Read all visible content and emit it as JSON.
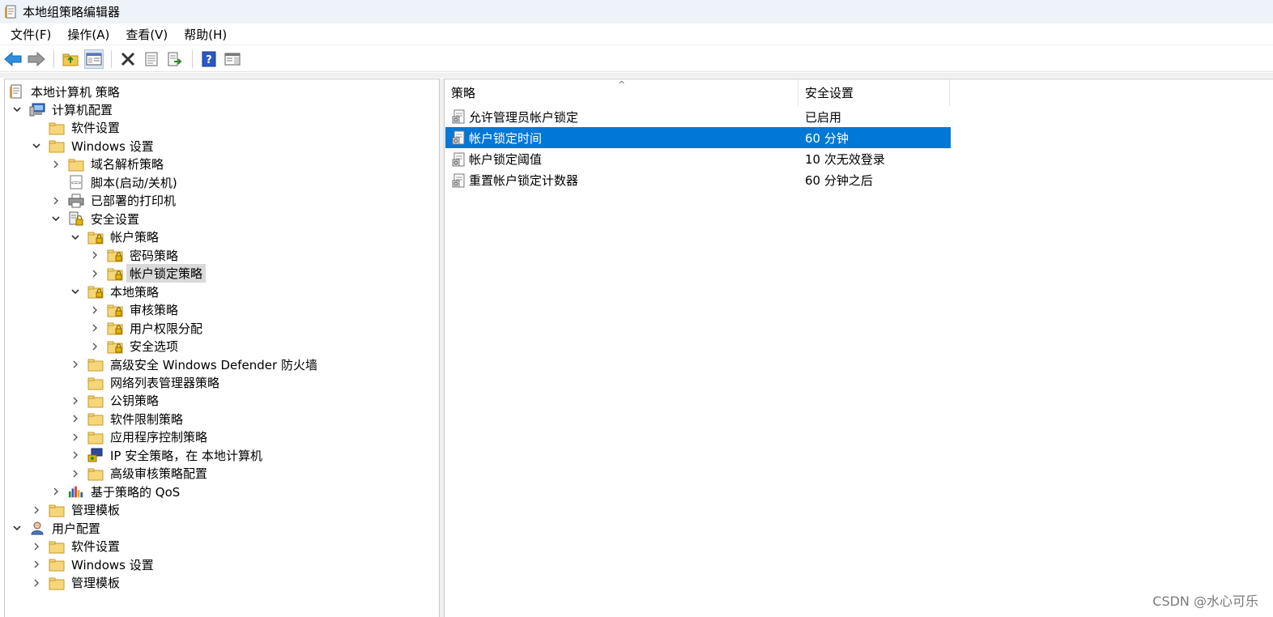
{
  "window": {
    "title": "本地组策略编辑器"
  },
  "menu": [
    "文件(F)",
    "操作(A)",
    "查看(V)",
    "帮助(H)"
  ],
  "toolbar": {
    "buttons": [
      {
        "name": "back-button",
        "icon": "arrow-left-icon"
      },
      {
        "name": "forward-button",
        "icon": "arrow-right-icon"
      },
      {
        "name": "up-folder-button",
        "icon": "folder-up-icon"
      },
      {
        "name": "show-hide-tree-button",
        "icon": "console-tree-icon"
      },
      {
        "name": "delete-button",
        "icon": "delete-x-icon"
      },
      {
        "name": "properties-button",
        "icon": "properties-icon"
      },
      {
        "name": "export-list-button",
        "icon": "export-icon"
      },
      {
        "name": "help-button",
        "icon": "help-icon"
      },
      {
        "name": "show-action-pane-button",
        "icon": "action-pane-icon"
      }
    ]
  },
  "tree": [
    {
      "label": "本地计算机 策略",
      "level": 0,
      "chevron": "none",
      "icon": "policy-document-icon"
    },
    {
      "label": "计算机配置",
      "level": 1,
      "chevron": "down",
      "icon": "computer-icon"
    },
    {
      "label": "软件设置",
      "level": 2,
      "chevron": "none",
      "icon": "folder-icon"
    },
    {
      "label": "Windows 设置",
      "level": 2,
      "chevron": "down",
      "icon": "folder-icon"
    },
    {
      "label": "域名解析策略",
      "level": 3,
      "chevron": "right",
      "icon": "folder-icon"
    },
    {
      "label": "脚本(启动/关机)",
      "level": 3,
      "chevron": "none",
      "icon": "script-icon"
    },
    {
      "label": "已部署的打印机",
      "level": 3,
      "chevron": "right",
      "icon": "printer-icon"
    },
    {
      "label": "安全设置",
      "level": 3,
      "chevron": "down",
      "icon": "security-settings-icon"
    },
    {
      "label": "帐户策略",
      "level": 4,
      "chevron": "down",
      "icon": "locked-folder-icon"
    },
    {
      "label": "密码策略",
      "level": 5,
      "chevron": "right",
      "icon": "locked-folder-icon"
    },
    {
      "label": "帐户锁定策略",
      "level": 5,
      "chevron": "right",
      "icon": "locked-folder-icon",
      "selected": true
    },
    {
      "label": "本地策略",
      "level": 4,
      "chevron": "down",
      "icon": "locked-folder-icon"
    },
    {
      "label": "审核策略",
      "level": 5,
      "chevron": "right",
      "icon": "locked-folder-icon"
    },
    {
      "label": "用户权限分配",
      "level": 5,
      "chevron": "right",
      "icon": "locked-folder-icon"
    },
    {
      "label": "安全选项",
      "level": 5,
      "chevron": "right",
      "icon": "locked-folder-icon"
    },
    {
      "label": "高级安全 Windows Defender 防火墙",
      "level": 4,
      "chevron": "right",
      "icon": "folder-icon"
    },
    {
      "label": "网络列表管理器策略",
      "level": 4,
      "chevron": "none",
      "icon": "folder-icon"
    },
    {
      "label": "公钥策略",
      "level": 4,
      "chevron": "right",
      "icon": "folder-icon"
    },
    {
      "label": "软件限制策略",
      "level": 4,
      "chevron": "right",
      "icon": "folder-icon"
    },
    {
      "label": "应用程序控制策略",
      "level": 4,
      "chevron": "right",
      "icon": "folder-icon"
    },
    {
      "label": "IP 安全策略，在 本地计算机",
      "level": 4,
      "chevron": "right",
      "icon": "ip-security-icon"
    },
    {
      "label": "高级审核策略配置",
      "level": 4,
      "chevron": "right",
      "icon": "folder-icon"
    },
    {
      "label": "基于策略的 QoS",
      "level": 3,
      "chevron": "right",
      "icon": "qos-chart-icon"
    },
    {
      "label": "管理模板",
      "level": 2,
      "chevron": "right",
      "icon": "folder-icon"
    },
    {
      "label": "用户配置",
      "level": 1,
      "chevron": "down",
      "icon": "user-icon"
    },
    {
      "label": "软件设置",
      "level": 2,
      "chevron": "right",
      "icon": "folder-icon"
    },
    {
      "label": "Windows 设置",
      "level": 2,
      "chevron": "right",
      "icon": "folder-icon"
    },
    {
      "label": "管理模板",
      "level": 2,
      "chevron": "right",
      "icon": "folder-icon"
    }
  ],
  "list": {
    "columns": {
      "policy": "策略",
      "setting": "安全设置"
    },
    "rows": [
      {
        "policy": "允许管理员帐户锁定",
        "setting": "已启用",
        "icon": "policy-item-icon"
      },
      {
        "policy": "帐户锁定时间",
        "setting": "60 分钟",
        "icon": "policy-item-icon",
        "selected": true
      },
      {
        "policy": "帐户锁定阈值",
        "setting": "10 次无效登录",
        "icon": "policy-item-icon"
      },
      {
        "policy": "重置帐户锁定计数器",
        "setting": "60 分钟之后",
        "icon": "policy-item-icon"
      }
    ]
  },
  "watermark": "CSDN @水心可乐",
  "colors": {
    "selection": "#0078d7",
    "tree_selection": "#d9d9d9",
    "folder": "#f5d77a"
  }
}
